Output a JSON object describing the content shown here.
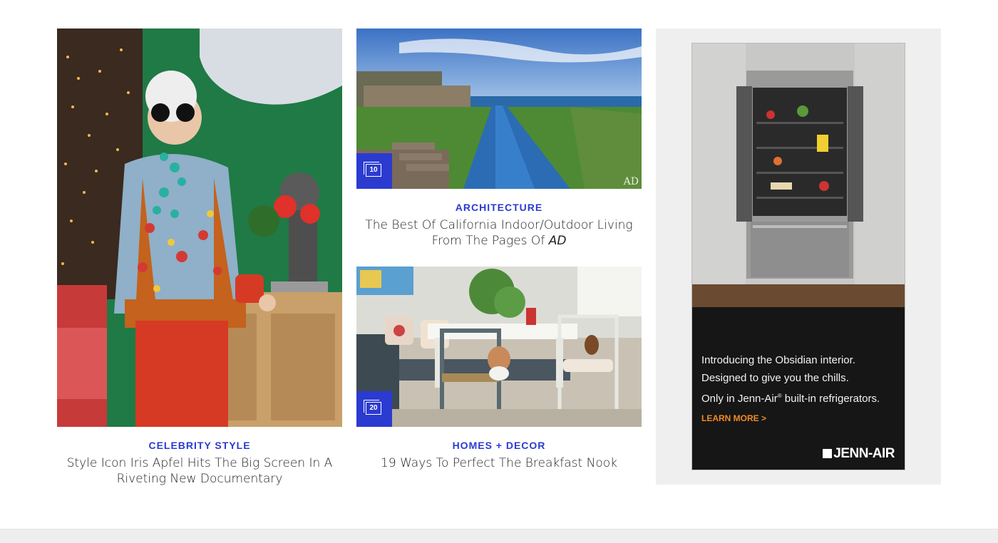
{
  "cards": [
    {
      "category": "CELEBRITY STYLE",
      "headline_line1": "Style Icon Iris Apfel Hits The Big Screen In A",
      "headline_line2": "Riveting New Documentary"
    },
    {
      "category": "ARCHITECTURE",
      "headline_line1": "The Best Of California Indoor/Outdoor Living",
      "headline_line2_prefix": "From The Pages Of ",
      "headline_line2_em": "AD",
      "gallery_count": "10",
      "watermark": "AD"
    },
    {
      "category": "HOMES + DECOR",
      "headline_line1": "19 Ways To Perfect The Breakfast Nook",
      "gallery_count": "20"
    }
  ],
  "ad": {
    "line1": "Introducing the Obsidian interior.",
    "line2": "Designed to give you the chills.",
    "line3_prefix": "Only in Jenn-Air",
    "line3_reg": "®",
    "line3_suffix": " built-in refrigerators.",
    "cta": "LEARN MORE >",
    "logo": "JENN-AIR"
  },
  "colors": {
    "accent": "#2b3bd0",
    "cta": "#f08a24",
    "ad_background": "#efefef"
  }
}
